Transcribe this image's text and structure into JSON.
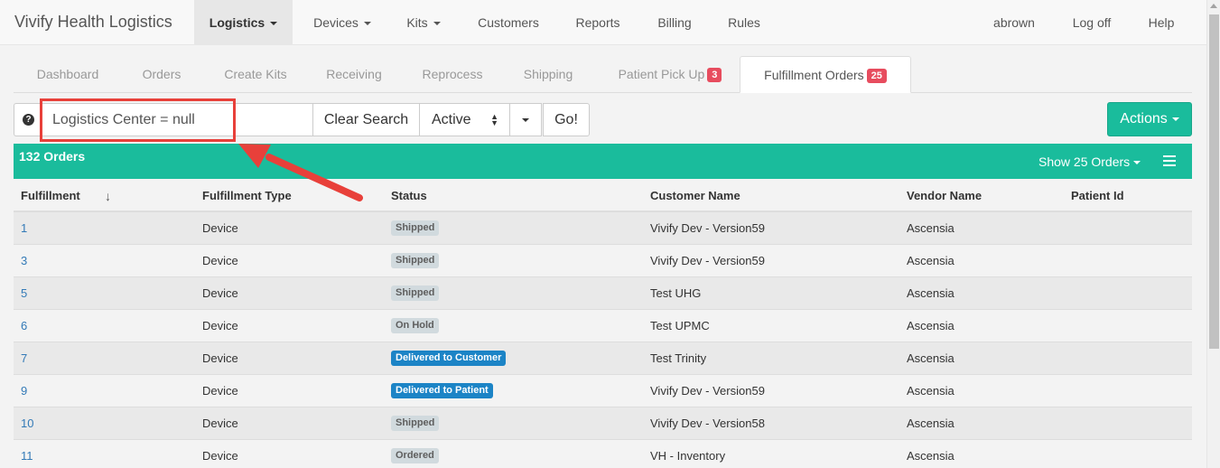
{
  "navbar": {
    "brand": "Vivify Health Logistics",
    "items": [
      {
        "label": "Logistics",
        "dropdown": true
      },
      {
        "label": "Devices",
        "dropdown": true
      },
      {
        "label": "Kits",
        "dropdown": true
      },
      {
        "label": "Customers"
      },
      {
        "label": "Reports"
      },
      {
        "label": "Billing"
      },
      {
        "label": "Rules"
      }
    ],
    "user": "abrown",
    "logoff": "Log off",
    "help": "Help"
  },
  "tabs": [
    {
      "label": "Dashboard"
    },
    {
      "label": "Orders"
    },
    {
      "label": "Create Kits"
    },
    {
      "label": "Receiving"
    },
    {
      "label": "Reprocess"
    },
    {
      "label": "Shipping"
    },
    {
      "label": "Patient Pick Up",
      "badge": "3"
    },
    {
      "label": "Fulfillment Orders",
      "badge": "25",
      "active": true
    }
  ],
  "search": {
    "help_icon": "?",
    "value": "Logistics Center = null",
    "clear_label": "Clear Search",
    "status_value": "Active",
    "go_label": "Go!",
    "actions_label": "Actions"
  },
  "orders": {
    "count_label": "132 Orders",
    "show_label": "Show 25 Orders"
  },
  "table": {
    "columns": [
      "Fulfillment",
      "Fulfillment Type",
      "Status",
      "Customer Name",
      "Vendor Name",
      "Patient Id"
    ],
    "sort_indicator": "↓",
    "rows": [
      {
        "id": "1",
        "type": "Device",
        "status": "Shipped",
        "status_style": "grey",
        "customer": "Vivify Dev - Version59",
        "vendor": "Ascensia",
        "patient": ""
      },
      {
        "id": "3",
        "type": "Device",
        "status": "Shipped",
        "status_style": "grey",
        "customer": "Vivify Dev - Version59",
        "vendor": "Ascensia",
        "patient": ""
      },
      {
        "id": "5",
        "type": "Device",
        "status": "Shipped",
        "status_style": "grey",
        "customer": "Test UHG",
        "vendor": "Ascensia",
        "patient": ""
      },
      {
        "id": "6",
        "type": "Device",
        "status": "On Hold",
        "status_style": "grey",
        "customer": "Test UPMC",
        "vendor": "Ascensia",
        "patient": ""
      },
      {
        "id": "7",
        "type": "Device",
        "status": "Delivered to Customer",
        "status_style": "blue",
        "customer": "Test Trinity",
        "vendor": "Ascensia",
        "patient": ""
      },
      {
        "id": "9",
        "type": "Device",
        "status": "Delivered to Patient",
        "status_style": "blue",
        "customer": "Vivify Dev - Version59",
        "vendor": "Ascensia",
        "patient": ""
      },
      {
        "id": "10",
        "type": "Device",
        "status": "Shipped",
        "status_style": "grey",
        "customer": "Vivify Dev - Version58",
        "vendor": "Ascensia",
        "patient": ""
      },
      {
        "id": "11",
        "type": "Device",
        "status": "Ordered",
        "status_style": "grey",
        "customer": "VH - Inventory",
        "vendor": "Ascensia",
        "patient": ""
      }
    ]
  },
  "colors": {
    "accent": "#1abc9c",
    "badge": "#e74c5e",
    "label_blue": "#1c84c6",
    "label_grey": "#d1dade",
    "annotation": "#e8403a",
    "link": "#337ab7"
  }
}
